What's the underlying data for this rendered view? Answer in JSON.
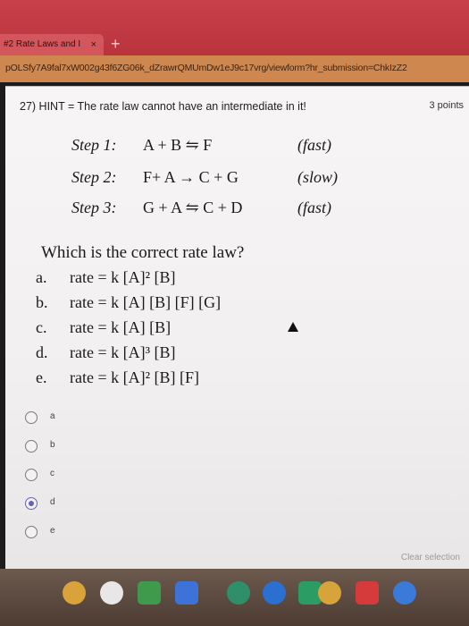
{
  "browser": {
    "tab_title": "#2 Rate Laws and I",
    "tab_close": "×",
    "new_tab": "+",
    "url": "pOLSfy7A9fal7xW002g43f6ZG06k_dZrawrQMUmDw1eJ9c17vrg/viewform?hr_submission=ChkIzZ2"
  },
  "question": {
    "number_and_hint": "27)  HINT = The rate law cannot have an intermediate in it!",
    "points": "3 points",
    "steps": [
      {
        "label": "Step 1:",
        "reaction": "A + B ⇋ F",
        "speed": "(fast)"
      },
      {
        "label": "Step 2:",
        "reaction": "F+ A → C + G",
        "speed": "(slow)"
      },
      {
        "label": "Step 3:",
        "reaction": "G + A ⇋ C + D",
        "speed": "(fast)"
      }
    ],
    "prompt": "Which is the correct rate law?",
    "choices": [
      {
        "letter": "a.",
        "text": "rate = k [A]² [B]"
      },
      {
        "letter": "b.",
        "text": "rate = k [A] [B] [F] [G]"
      },
      {
        "letter": "c.",
        "text": "rate = k [A] [B]"
      },
      {
        "letter": "d.",
        "text": "rate = k [A]³ [B]"
      },
      {
        "letter": "e.",
        "text": "rate = k [A]² [B] [F]"
      }
    ]
  },
  "answers": {
    "options": [
      "a",
      "b",
      "c",
      "d",
      "e"
    ],
    "selected": "d"
  },
  "footer": {
    "clear_selection": "Clear selection"
  },
  "shelf": {
    "apps": [
      {
        "name": "chrome-icon",
        "color": "#d9a23a"
      },
      {
        "name": "gmail-icon",
        "color": "#e8e6e6"
      },
      {
        "name": "classroom-icon",
        "color": "#3f9a4e"
      },
      {
        "name": "docs-icon",
        "color": "#3d72d6"
      },
      {
        "name": "drive-icon",
        "color": "#2f8f6b"
      },
      {
        "name": "files-icon",
        "color": "#2b6fd0"
      },
      {
        "name": "play-store-icon",
        "color": "#2b9c63"
      },
      {
        "name": "photos-icon",
        "color": "#d7a33b"
      },
      {
        "name": "youtube-icon",
        "color": "#d63b3b"
      },
      {
        "name": "app-icon",
        "color": "#3b7ad8"
      }
    ]
  }
}
